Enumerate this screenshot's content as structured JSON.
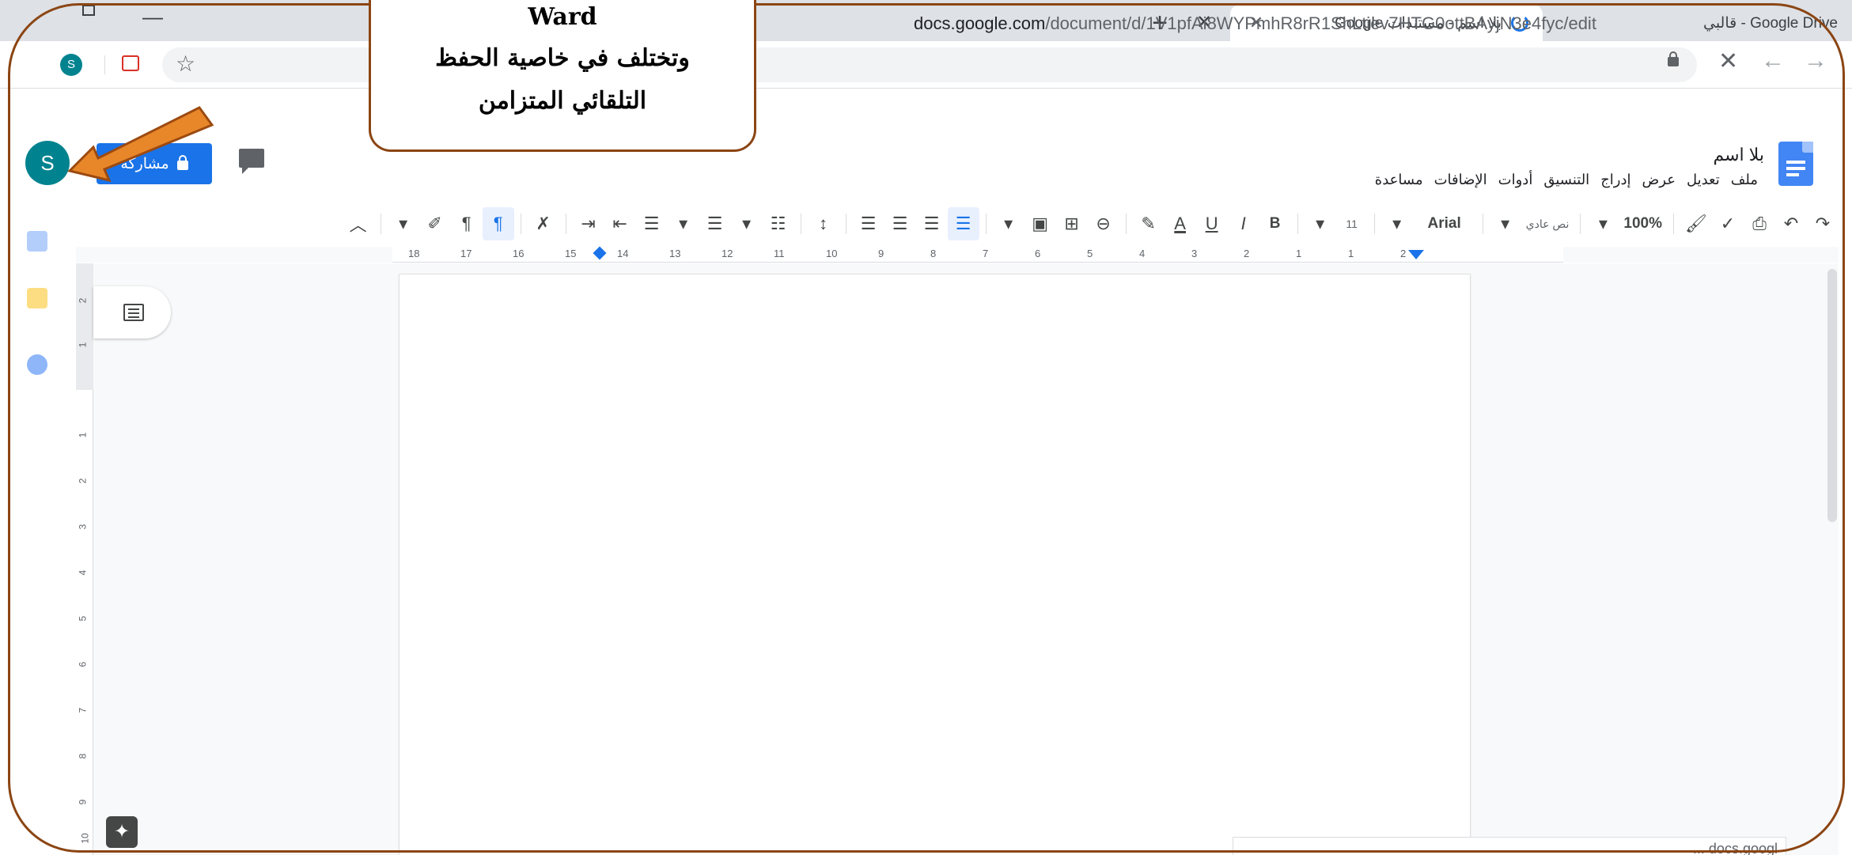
{
  "browser": {
    "tabs": [
      {
        "title": "بلا اسم - مستندات Google",
        "active": true
      },
      {
        "title": "Google Drive - قالبي",
        "active": false
      }
    ],
    "url_host": "docs.google.com",
    "url_path": "/document/d/1V1pfAi8WYPmhR8rR1ShLtiev7HTG0ottBAyjN3e4fyc/edit",
    "profile_letter": "S"
  },
  "docs": {
    "title": "بلا اسم",
    "menu": [
      "ملف",
      "تعديل",
      "عرض",
      "إدراج",
      "التنسيق",
      "أدوات",
      "الإضافات",
      "مساعدة"
    ],
    "share_label": "مشاركة",
    "avatar_letter": "S"
  },
  "toolbar": {
    "zoom": "100%",
    "style": "نص عادي",
    "font": "Arial",
    "font_size": "11",
    "bold": "B",
    "italic": "I",
    "underline": "U",
    "text_color": "A"
  },
  "ruler": {
    "numbers": [
      "18",
      "17",
      "16",
      "15",
      "14",
      "13",
      "12",
      "11",
      "10",
      "9",
      "8",
      "7",
      "6",
      "5",
      "4",
      "3",
      "2",
      "1",
      "1",
      "2"
    ],
    "vertical_numbers": [
      "2",
      "1",
      "1",
      "2",
      "3",
      "4",
      "5",
      "6",
      "7",
      "8",
      "9",
      "10"
    ]
  },
  "callout": {
    "line1": "Ward",
    "line2": "وتختلف في خاصية الحفظ",
    "line3": "التلقائي المتزامن"
  },
  "toast": {
    "text": "... docs.googl"
  },
  "colors": {
    "accent": "#1a73e8",
    "frame": "#8b4513",
    "arrow": "#e8872a"
  }
}
